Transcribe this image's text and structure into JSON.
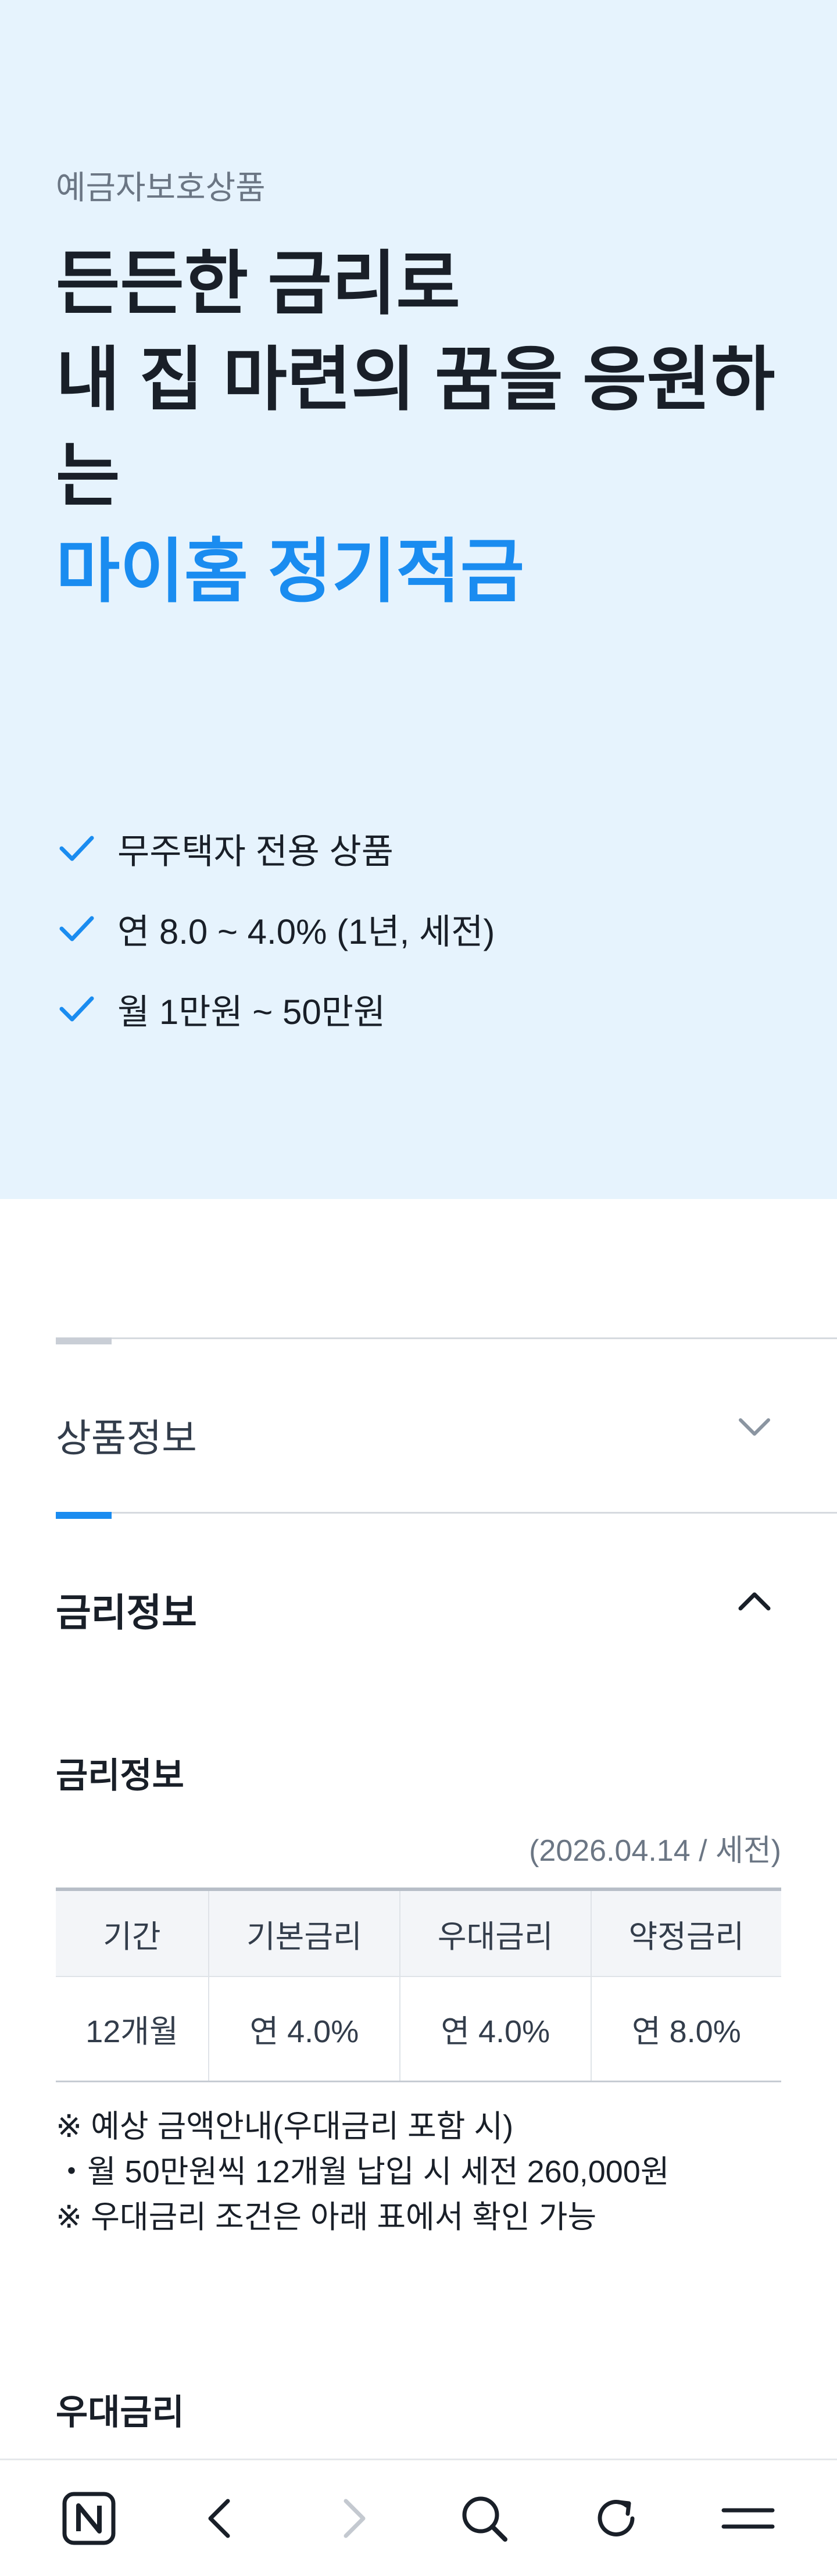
{
  "hero": {
    "badge": "예금자보호상품",
    "title_line1": "든든한 금리로",
    "title_line2": "내 집 마련의 꿈을 응원하",
    "title_line3": "는",
    "product_name": "마이홈 정기적금",
    "features": [
      {
        "icon": "check-icon",
        "text": "무주택자 전용 상품"
      },
      {
        "icon": "check-icon",
        "text": "연 8.0 ~ 4.0% (1년, 세전)"
      },
      {
        "icon": "check-icon",
        "text": "월 1만원 ~ 50만원"
      }
    ]
  },
  "accordion": {
    "product_info": {
      "title": "상품정보",
      "expanded": false,
      "icon": "chevron-down-icon"
    },
    "rate_info": {
      "title": "금리정보",
      "expanded": true,
      "icon": "chevron-up-icon"
    }
  },
  "rate_section": {
    "title": "금리정보",
    "date_note": "(2026.04.14 / 세전)",
    "table": {
      "headers": [
        "기간",
        "기본금리",
        "우대금리",
        "약정금리"
      ],
      "rows": [
        [
          "12개월",
          "연 4.0%",
          "연 4.0%",
          "연 8.0%"
        ]
      ]
    },
    "notes": [
      "※ 예상 금액안내(우대금리 포함 시)",
      "・월 50만원씩 12개월 납입 시 세전 260,000원",
      "※ 우대금리 조건은 아래 표에서 확인 가능"
    ]
  },
  "preferential_section": {
    "title": "우대금리"
  },
  "bottom_bar": {
    "items": [
      {
        "name": "naver-home-icon"
      },
      {
        "name": "back-icon"
      },
      {
        "name": "forward-icon",
        "disabled": true
      },
      {
        "name": "search-icon"
      },
      {
        "name": "refresh-icon"
      },
      {
        "name": "menu-icon"
      }
    ]
  },
  "colors": {
    "hero_bg": "#e6f3fd",
    "accent": "#1a8cf0",
    "text": "#191f28",
    "muted": "#6b7684"
  }
}
